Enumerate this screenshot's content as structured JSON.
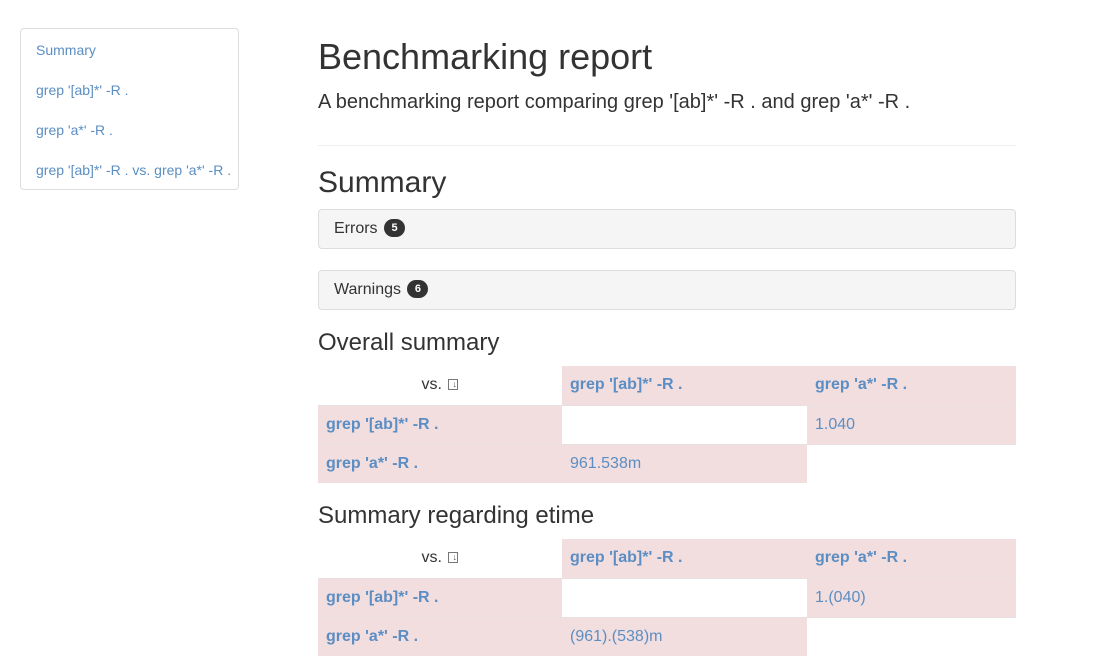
{
  "sidebar": {
    "items": [
      {
        "label": "Summary"
      },
      {
        "label": "grep '[ab]*' -R ."
      },
      {
        "label": "grep 'a*' -R ."
      },
      {
        "label": "grep '[ab]*' -R . vs. grep 'a*' -R ."
      }
    ]
  },
  "header": {
    "title": "Benchmarking report",
    "subtitle": "A benchmarking report comparing grep '[ab]*' -R . and grep 'a*' -R ."
  },
  "summary": {
    "title": "Summary",
    "errors": {
      "label": "Errors",
      "count": "5"
    },
    "warnings": {
      "label": "Warnings",
      "count": "6"
    }
  },
  "overall": {
    "title": "Overall summary",
    "vs_label": "vs.",
    "columns": [
      "grep '[ab]*' -R .",
      "grep 'a*' -R ."
    ],
    "rows": [
      {
        "label": "grep '[ab]*' -R .",
        "cells": [
          "",
          "1.040"
        ]
      },
      {
        "label": "grep 'a*' -R .",
        "cells": [
          "961.538m",
          ""
        ]
      }
    ]
  },
  "etime": {
    "title": "Summary regarding etime",
    "vs_label": "vs.",
    "columns": [
      "grep '[ab]*' -R .",
      "grep 'a*' -R ."
    ],
    "rows": [
      {
        "label": "grep '[ab]*' -R .",
        "cells": [
          "",
          "1.(040)"
        ]
      },
      {
        "label": "grep 'a*' -R .",
        "cells": [
          "(961).(538)m",
          ""
        ]
      }
    ]
  },
  "colors": {
    "link": "#5b8ec4",
    "highlight": "#f2dede",
    "badge": "#333333"
  }
}
